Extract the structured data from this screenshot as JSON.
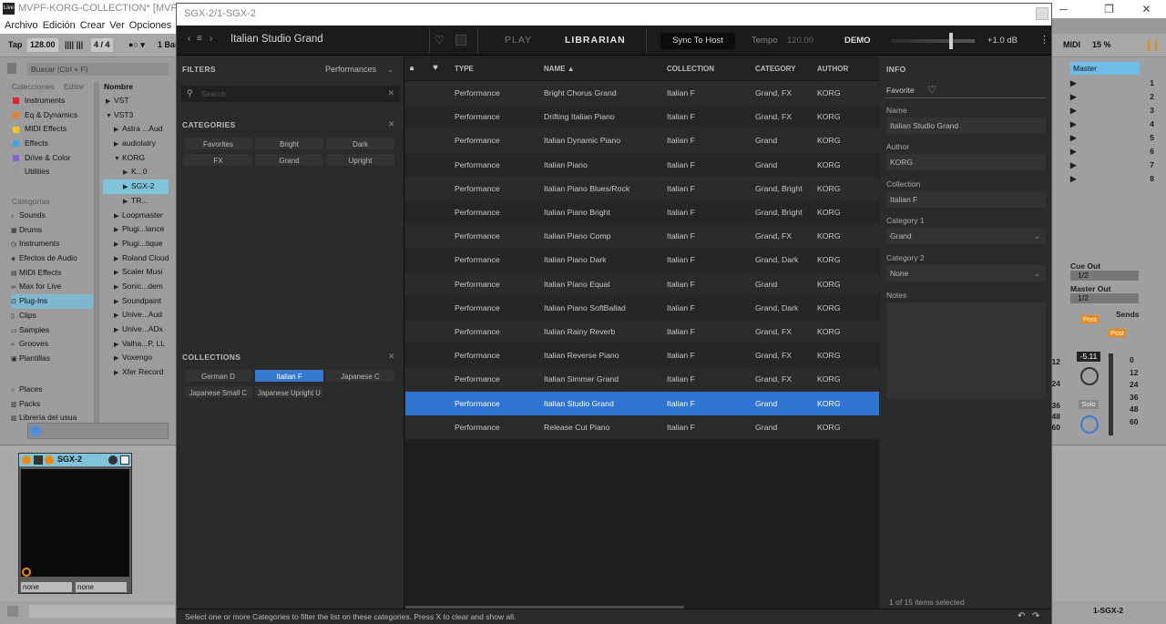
{
  "host": {
    "title": "MVPF-KORG-COLLECTION* [MVPF-KOR",
    "menu": [
      "Archivo",
      "Edición",
      "Crear",
      "Ver",
      "Opciones"
    ],
    "transport": {
      "tap": "Tap",
      "tempo": "128.00",
      "sig": "4 / 4",
      "bar": "1 Bar",
      "midi": "MIDI",
      "cpu": "15 %"
    },
    "search_placeholder": "Buscar (Ctrl + F)",
    "collections_label": "Colecciones",
    "edit_label": "Editar",
    "collections": [
      {
        "label": "Instruments",
        "color": "#e0242a"
      },
      {
        "label": "Eq & Dynamics",
        "color": "#f07e24"
      },
      {
        "label": "MIDI Effects",
        "color": "#f5c31c"
      },
      {
        "label": "Effects",
        "color": "#3fa3e6"
      },
      {
        "label": "Drive & Color",
        "color": "#2b6fd8"
      },
      {
        "label": "Utilities",
        "color": "#9a9a9a"
      }
    ],
    "categories_label": "Categorías",
    "categories": [
      "Sounds",
      "Drums",
      "Instruments",
      "Efectos de Audio",
      "MIDI Effects",
      "Max for Live",
      "Plug-Ins",
      "Clips",
      "Samples",
      "Grooves",
      "Plantillas"
    ],
    "places_label": "Places",
    "places": [
      "Packs",
      "Librería del usua"
    ],
    "name_header": "Nombre",
    "tree": [
      "VST",
      "VST3",
      "Astra ...Aud",
      "audiolatry",
      "KORG",
      "K...0",
      "SGX-2",
      "TR...",
      "Loopmaster",
      "Plugi...lance",
      "Plugi...tique",
      "Roland Cloud",
      "Scaler Musi",
      "Sonic...dem",
      "Soundpaint",
      "Unive...Aud",
      "Unive...ADx",
      "Valha...P, LL",
      "Voxengo",
      "Xfer Record"
    ],
    "device": {
      "name": "SGX-2",
      "sel1": "none",
      "sel2": "none"
    },
    "master": "Master",
    "track_nums": [
      "1",
      "2",
      "3",
      "4",
      "5",
      "6",
      "7",
      "8"
    ],
    "cue_out_label": "Cue Out",
    "cue_out": "1/2",
    "master_out_label": "Master Out",
    "master_out": "1/2",
    "sends_label": "Sends",
    "post": "Post",
    "vol_readout": "-5.11",
    "solo": "Solo",
    "meter_marks": [
      "0",
      "12",
      "24",
      "36",
      "48",
      "60"
    ],
    "bottom_track": "1-SGX-2"
  },
  "plugin": {
    "title": "SGX-2/1-SGX-2",
    "preset_name": "Italian Studio Grand",
    "tab_play": "PLAY",
    "tab_librarian": "LIBRARIAN",
    "sync_to_host": "Sync To Host",
    "tempo_label": "Tempo",
    "tempo_value": "120.00",
    "demo": "DEMO",
    "volume_db": "+1.0 dB",
    "filters_label": "FILTERS",
    "filter_type": "Performances",
    "search_placeholder": "Search",
    "categories_label": "CATEGORIES",
    "category_chips": [
      "Favorites",
      "Bright",
      "Dark",
      "FX",
      "Grand",
      "Upright"
    ],
    "collections_label": "COLLECTIONS",
    "collection_chips": [
      {
        "label": "German D",
        "selected": false
      },
      {
        "label": "Italian F",
        "selected": true
      },
      {
        "label": "Japanese C",
        "selected": false
      },
      {
        "label": "Japanese Small C",
        "selected": false
      },
      {
        "label": "Japanese Upright U",
        "selected": false
      }
    ],
    "columns": {
      "type": "TYPE",
      "name": "NAME ▲",
      "collection": "COLLECTION",
      "category": "CATEGORY",
      "author": "AUTHOR"
    },
    "rows": [
      {
        "type": "Performance",
        "name": "Bright Chorus Grand",
        "collection": "Italian F",
        "category": "Grand, FX",
        "author": "KORG"
      },
      {
        "type": "Performance",
        "name": "Drifting Italian Piano",
        "collection": "Italian F",
        "category": "Grand, FX",
        "author": "KORG"
      },
      {
        "type": "Performance",
        "name": "Italian Dynamic Piano",
        "collection": "Italian F",
        "category": "Grand",
        "author": "KORG"
      },
      {
        "type": "Performance",
        "name": "Italian Piano",
        "collection": "Italian F",
        "category": "Grand",
        "author": "KORG"
      },
      {
        "type": "Performance",
        "name": "Italian Piano Blues/Rock",
        "collection": "Italian F",
        "category": "Grand, Bright",
        "author": "KORG"
      },
      {
        "type": "Performance",
        "name": "Italian Piano Bright",
        "collection": "Italian F",
        "category": "Grand, Bright",
        "author": "KORG"
      },
      {
        "type": "Performance",
        "name": "Italian Piano Comp",
        "collection": "Italian F",
        "category": "Grand, FX",
        "author": "KORG"
      },
      {
        "type": "Performance",
        "name": "Italian Piano Dark",
        "collection": "Italian F",
        "category": "Grand, Dark",
        "author": "KORG"
      },
      {
        "type": "Performance",
        "name": "Italian Piano Equal",
        "collection": "Italian F",
        "category": "Grand",
        "author": "KORG"
      },
      {
        "type": "Performance",
        "name": "Italian Piano SoftBallad",
        "collection": "Italian F",
        "category": "Grand, Dark",
        "author": "KORG"
      },
      {
        "type": "Performance",
        "name": "Italian Rainy Reverb",
        "collection": "Italian F",
        "category": "Grand, FX",
        "author": "KORG"
      },
      {
        "type": "Performance",
        "name": "Italian Reverse Piano",
        "collection": "Italian F",
        "category": "Grand, FX",
        "author": "KORG"
      },
      {
        "type": "Performance",
        "name": "Italian Simmer Grand",
        "collection": "Italian F",
        "category": "Grand, FX",
        "author": "KORG"
      },
      {
        "type": "Performance",
        "name": "Italian Studio Grand",
        "collection": "Italian F",
        "category": "Grand",
        "author": "KORG",
        "selected": true
      },
      {
        "type": "Performance",
        "name": "Release Cut Piano",
        "collection": "Italian F",
        "category": "Grand",
        "author": "KORG"
      }
    ],
    "info": {
      "header": "INFO",
      "favorite_label": "Favorite",
      "name_label": "Name",
      "name_value": "Italian Studio Grand",
      "author_label": "Author",
      "author_value": "KORG",
      "collection_label": "Collection",
      "collection_value": "Italian F",
      "category1_label": "Category 1",
      "category1_value": "Grand",
      "category2_label": "Category 2",
      "category2_value": "None",
      "notes_label": "Notes"
    },
    "selection_status": "1 of 15 items selected",
    "hint": "Select one or more Categories to filter the list on these categories. Press X to clear and show all."
  },
  "colors": {
    "accent": "#2f73d3",
    "plugin_bg": "#242424",
    "host_bg": "#9c9c9c"
  }
}
